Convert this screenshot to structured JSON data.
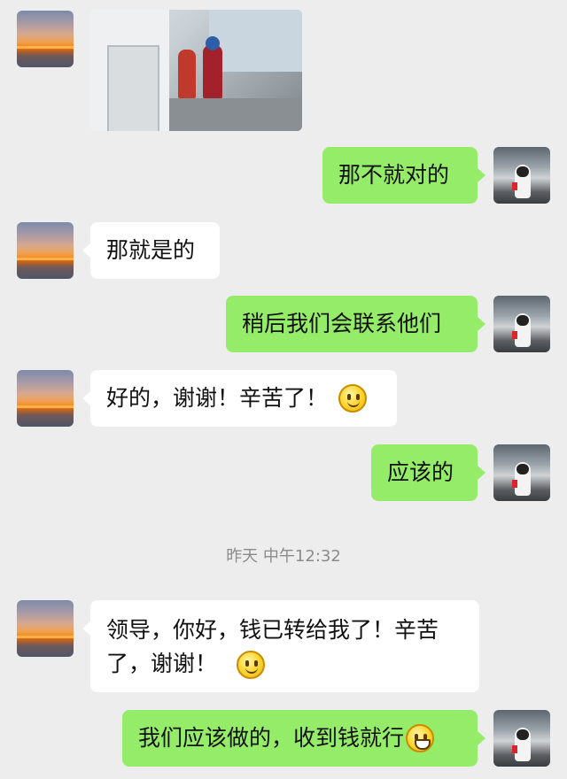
{
  "messages": [
    {
      "id": "m1",
      "side": "in",
      "type": "image"
    },
    {
      "id": "m2",
      "side": "out",
      "text": "那不就对的"
    },
    {
      "id": "m3",
      "side": "in",
      "text": "那就是的"
    },
    {
      "id": "m4",
      "side": "out",
      "text": "稍后我们会联系他们"
    },
    {
      "id": "m5",
      "side": "in",
      "text": "好的，谢谢！辛苦了！",
      "emoji": "smile"
    },
    {
      "id": "m6",
      "side": "out",
      "text": "应该的"
    },
    {
      "id": "m7",
      "side": "in",
      "line1": "领导，你好，钱已转给我了！辛苦",
      "line2": "了，谢谢！",
      "emoji": "smile"
    },
    {
      "id": "m8",
      "side": "out",
      "text": "我们应该做的，收到钱就行",
      "emoji": "grin"
    }
  ],
  "timestamp": "昨天 中午12:32",
  "colors": {
    "background": "#ededed",
    "incoming": "#ffffff",
    "outgoing": "#95ec69"
  },
  "avatars": {
    "contact": "sunset-avatar",
    "self": "astronaut-avatar"
  }
}
